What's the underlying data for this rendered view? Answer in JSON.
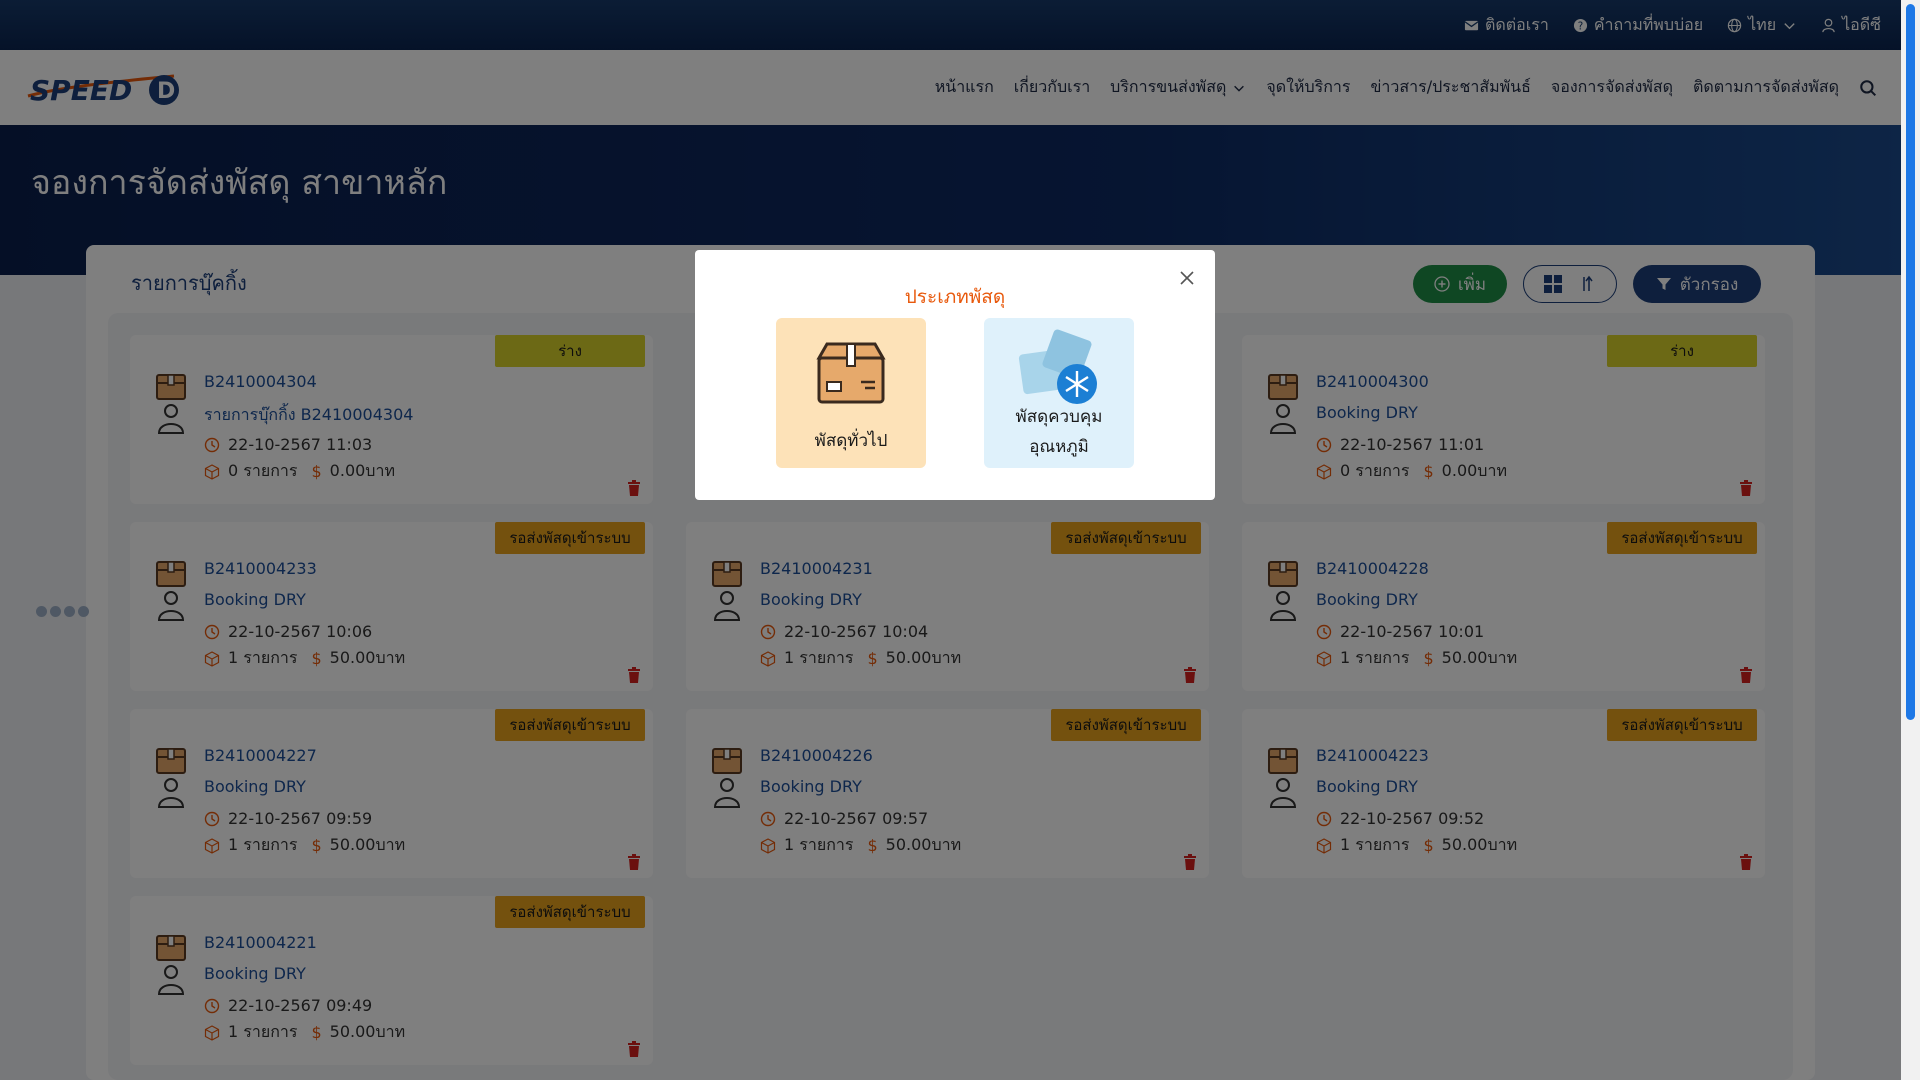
{
  "topbar": {
    "contact": "ติดต่อเรา",
    "faq": "คำถามที่พบบ่อย",
    "language": "ไทย",
    "user": "ไอดีซี"
  },
  "navbar": {
    "logo_text": "SPEED-D",
    "items": [
      "หน้าแรก",
      "เกี่ยวกับเรา",
      "บริการขนส่งพัสดุ",
      "จุดให้บริการ",
      "ข่าวสาร/ประชาสัมพันธ์",
      "จองการจัดส่งพัสดุ",
      "ติดตามการจัดส่งพัสดุ"
    ]
  },
  "hero": {
    "title": "จองการจัดส่งพัสดุ สาขาหลัก"
  },
  "panel": {
    "title": "รายการบุ๊คกิ้ง",
    "add_label": "เพิ่ม",
    "filter_label": "ตัวกรอง"
  },
  "cards": [
    {
      "code": "B2410004304",
      "subtitle": "รายการบุ๊กกิ้ง B2410004304",
      "datetime": "22-10-2567 11:03",
      "items": "0 รายการ",
      "amount": "0.00บาท",
      "status": "ร่าง",
      "status_type": "draft"
    },
    {
      "code": "",
      "subtitle": "",
      "datetime": "",
      "items": "",
      "amount": "",
      "status": "",
      "status_type": "hidden"
    },
    {
      "code": "B2410004300",
      "subtitle": "Booking DRY",
      "datetime": "22-10-2567 11:01",
      "items": "0 รายการ",
      "amount": "0.00บาท",
      "status": "ร่าง",
      "status_type": "draft"
    },
    {
      "code": "B2410004233",
      "subtitle": "Booking DRY",
      "datetime": "22-10-2567 10:06",
      "items": "1 รายการ",
      "amount": "50.00บาท",
      "status": "รอส่งพัสดุเข้าระบบ",
      "status_type": "wait"
    },
    {
      "code": "B2410004231",
      "subtitle": "Booking DRY",
      "datetime": "22-10-2567 10:04",
      "items": "1 รายการ",
      "amount": "50.00บาท",
      "status": "รอส่งพัสดุเข้าระบบ",
      "status_type": "wait"
    },
    {
      "code": "B2410004228",
      "subtitle": "Booking DRY",
      "datetime": "22-10-2567 10:01",
      "items": "1 รายการ",
      "amount": "50.00บาท",
      "status": "รอส่งพัสดุเข้าระบบ",
      "status_type": "wait"
    },
    {
      "code": "B2410004227",
      "subtitle": "Booking DRY",
      "datetime": "22-10-2567 09:59",
      "items": "1 รายการ",
      "amount": "50.00บาท",
      "status": "รอส่งพัสดุเข้าระบบ",
      "status_type": "wait"
    },
    {
      "code": "B2410004226",
      "subtitle": "Booking DRY",
      "datetime": "22-10-2567 09:57",
      "items": "1 รายการ",
      "amount": "50.00บาท",
      "status": "รอส่งพัสดุเข้าระบบ",
      "status_type": "wait"
    },
    {
      "code": "B2410004223",
      "subtitle": "Booking DRY",
      "datetime": "22-10-2567 09:52",
      "items": "1 รายการ",
      "amount": "50.00บาท",
      "status": "รอส่งพัสดุเข้าระบบ",
      "status_type": "wait"
    },
    {
      "code": "B2410004221",
      "subtitle": "Booking DRY",
      "datetime": "22-10-2567 09:49",
      "items": "1 รายการ",
      "amount": "50.00บาท",
      "status": "รอส่งพัสดุเข้าระบบ",
      "status_type": "wait"
    }
  ],
  "modal": {
    "title": "ประเภทพัสดุ",
    "option_general": "พัสดุทั่วไป",
    "option_cold_line1": "พัสดุควบคุม",
    "option_cold_line2": "อุณหภูมิ"
  },
  "colors": {
    "brand_navy": "#0b2551",
    "accent_green": "#1e8f47",
    "badge_draft": "#d8d22a",
    "badge_wait": "#e8a21d",
    "modal_title": "#e8590c"
  }
}
